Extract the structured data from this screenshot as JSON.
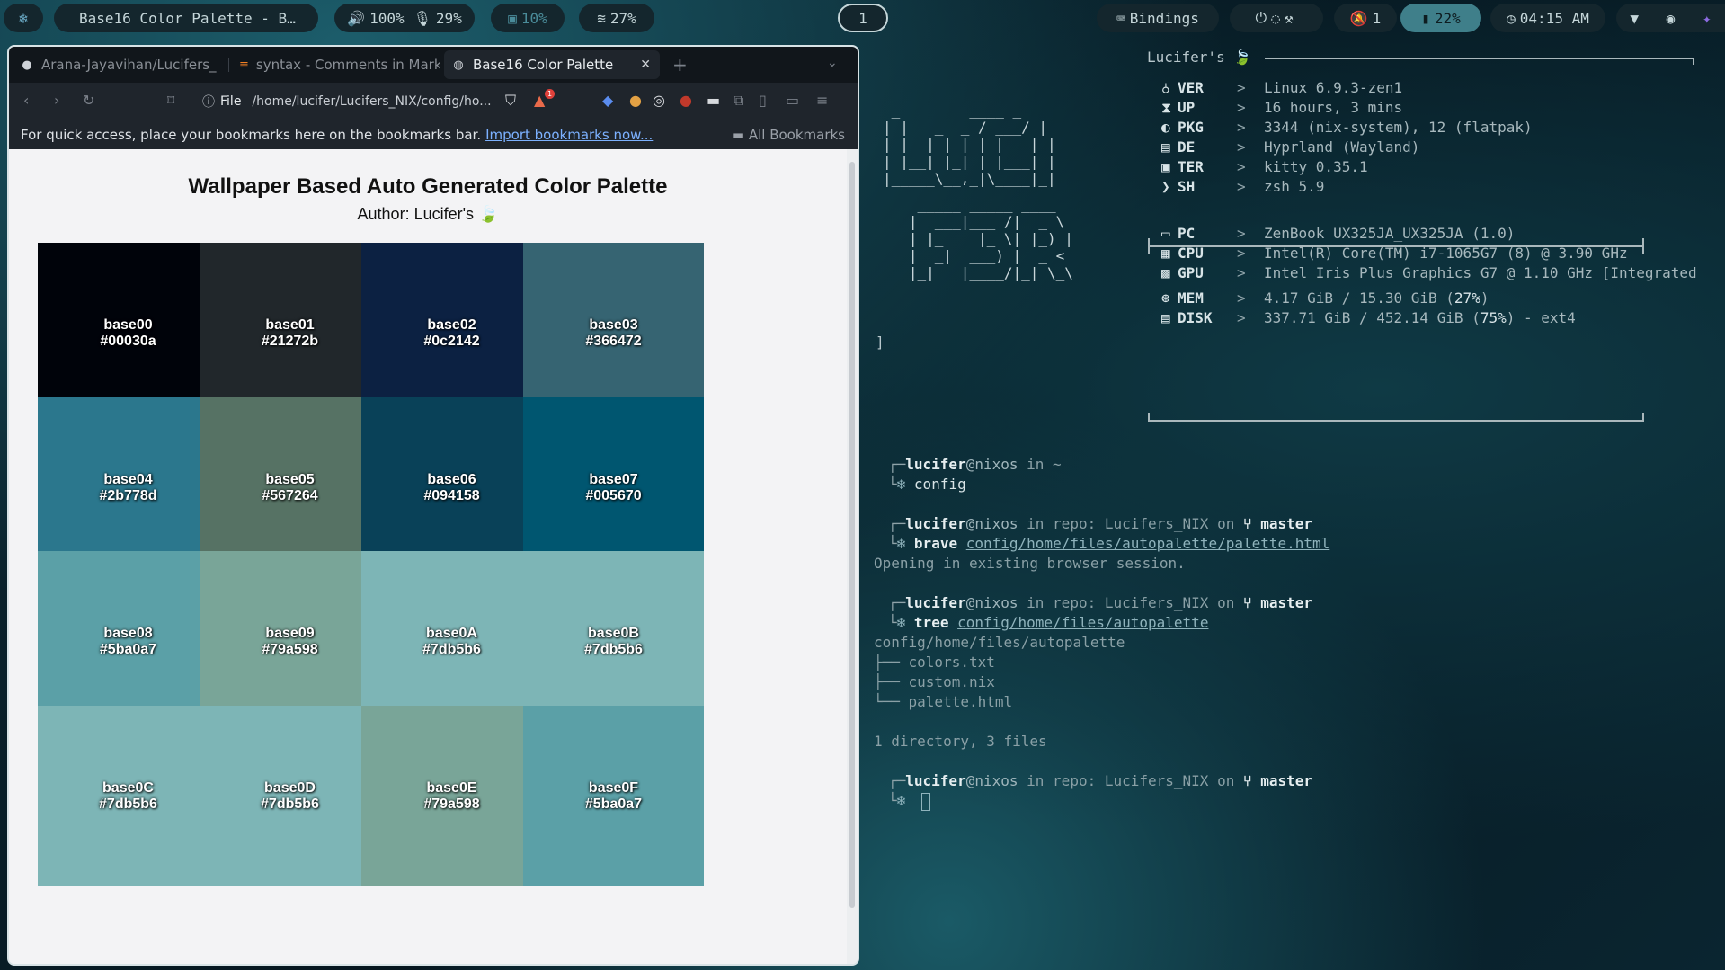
{
  "topbar": {
    "launcher_icon": "snowflake-icon",
    "window_title": "Base16 Color Palette - B…",
    "volume": "100%",
    "mic": "29%",
    "cpu": "10%",
    "disk": "27%",
    "workspace": "1",
    "bindings": "Bindings",
    "notifications": "1",
    "battery": "22%",
    "clock": "04:15 AM"
  },
  "browser": {
    "tabs": [
      {
        "label": "Arana-Jayavihan/Lucifers_",
        "icon": "github-icon"
      },
      {
        "label": "syntax - Comments in Mark",
        "icon": "stackoverflow-icon"
      },
      {
        "label": "Base16 Color Palette",
        "icon": "globe-icon"
      }
    ],
    "address_scheme": "File",
    "address": "/home/lucifer/Lucifers_NIX/config/ho...",
    "shield_badge": "1",
    "bookmarks_message": "For quick access, place your bookmarks here on the bookmarks bar.",
    "bookmarks_link": "Import bookmarks now...",
    "all_bookmarks": "All Bookmarks"
  },
  "page": {
    "title": "Wallpaper Based Auto Generated Color Palette",
    "author": "Author: Lucifer's 🍃",
    "swatches": [
      {
        "name": "base00",
        "hex": "#00030a",
        "color": "#00030a"
      },
      {
        "name": "base01",
        "hex": "#21272b",
        "color": "#21272b"
      },
      {
        "name": "base02",
        "hex": "#0c2142",
        "color": "#0c2142"
      },
      {
        "name": "base03",
        "hex": "#366472",
        "color": "#366472"
      },
      {
        "name": "base04",
        "hex": "#2b778d",
        "color": "#2b778d"
      },
      {
        "name": "base05",
        "hex": "#567264",
        "color": "#567264"
      },
      {
        "name": "base06",
        "hex": "#094158",
        "color": "#094158"
      },
      {
        "name": "base07",
        "hex": "#005670",
        "color": "#005670"
      },
      {
        "name": "base08",
        "hex": "#5ba0a7",
        "color": "#5ba0a7"
      },
      {
        "name": "base09",
        "hex": "#79a598",
        "color": "#79a598"
      },
      {
        "name": "base0A",
        "hex": "#7db5b6",
        "color": "#7db5b6"
      },
      {
        "name": "base0B",
        "hex": "#7db5b6",
        "color": "#7db5b6"
      },
      {
        "name": "base0C",
        "hex": "#7db5b6",
        "color": "#7db5b6"
      },
      {
        "name": "base0D",
        "hex": "#7db5b6",
        "color": "#7db5b6"
      },
      {
        "name": "base0E",
        "hex": "#79a598",
        "color": "#79a598"
      },
      {
        "name": "base0F",
        "hex": "#5ba0a7",
        "color": "#5ba0a7"
      }
    ]
  },
  "terminal": {
    "fetch_header": "Lucifer's 🍃",
    "ascii_art": [
      " _        ____ _",
      "| |   _  _ / ___/ |",
      "| |  | | | | |   | |",
      "| |__| |_| | |___| |",
      "|_____\\__,_|\\____|_|",
      "    _____ _____ ____",
      "   |  ___|___ /|  _ \\",
      "   | |_    |_ \\| |_) |",
      "   |  _|  ___) |  _ <",
      "   |_|   |____/|_| \\_\\"
    ],
    "stray": "]",
    "info_sys": [
      {
        "icon": "flask-icon",
        "key": "VER",
        "value": "Linux 6.9.3-zen1"
      },
      {
        "icon": "hourglass-icon",
        "key": "UP",
        "value": "16 hours, 3 mins"
      },
      {
        "icon": "package-icon",
        "key": "PKG",
        "value": "3344 (nix-system), 12 (flatpak)"
      },
      {
        "icon": "desktop-icon",
        "key": "DE",
        "value": "Hyprland (Wayland)"
      },
      {
        "icon": "terminal-icon",
        "key": "TER",
        "value": "kitty 0.35.1"
      },
      {
        "icon": "prompt-icon",
        "key": "SH",
        "value": "zsh 5.9"
      }
    ],
    "info_hw": [
      {
        "icon": "laptop-icon",
        "key": "PC",
        "value": "ZenBook UX325JA_UX325JA (1.0)"
      },
      {
        "icon": "chip-icon",
        "key": "CPU",
        "value": "Intel(R) Core(TM) i7-1065G7 (8) @ 3.90 GHz"
      },
      {
        "icon": "gpu-icon",
        "key": "GPU",
        "value": "Intel Iris Plus Graphics G7 @ 1.10 GHz [Integrated"
      }
    ],
    "info_mem": [
      {
        "icon": "memory-icon",
        "key": "MEM",
        "value": "4.17 GiB / 15.30 GiB (",
        "pct": "27%",
        "tail": ")"
      },
      {
        "icon": "harddisk-icon",
        "key": "DISK",
        "value": "337.71 GiB / 452.14 GiB (",
        "pct": "75%",
        "tail": ") - ext4"
      }
    ],
    "user": "lucifer",
    "at_host": "@nixos",
    "in": "in",
    "home_dir": "~",
    "repo_dir": "repo: Lucifers_NIX",
    "on": "on",
    "branch": "master",
    "cmd1": "config",
    "cmd2_name": "brave",
    "cmd2_arg": "config/home/files/autopalette/palette.html",
    "out2": "Opening in existing browser session.",
    "cmd3_name": "tree",
    "cmd3_arg": "config/home/files/autopalette",
    "tree_root": "config/home/files/autopalette",
    "tree_items": [
      "├── colors.txt",
      "├── custom.nix",
      "└── palette.html"
    ],
    "tree_summary": "1 directory, 3 files"
  }
}
